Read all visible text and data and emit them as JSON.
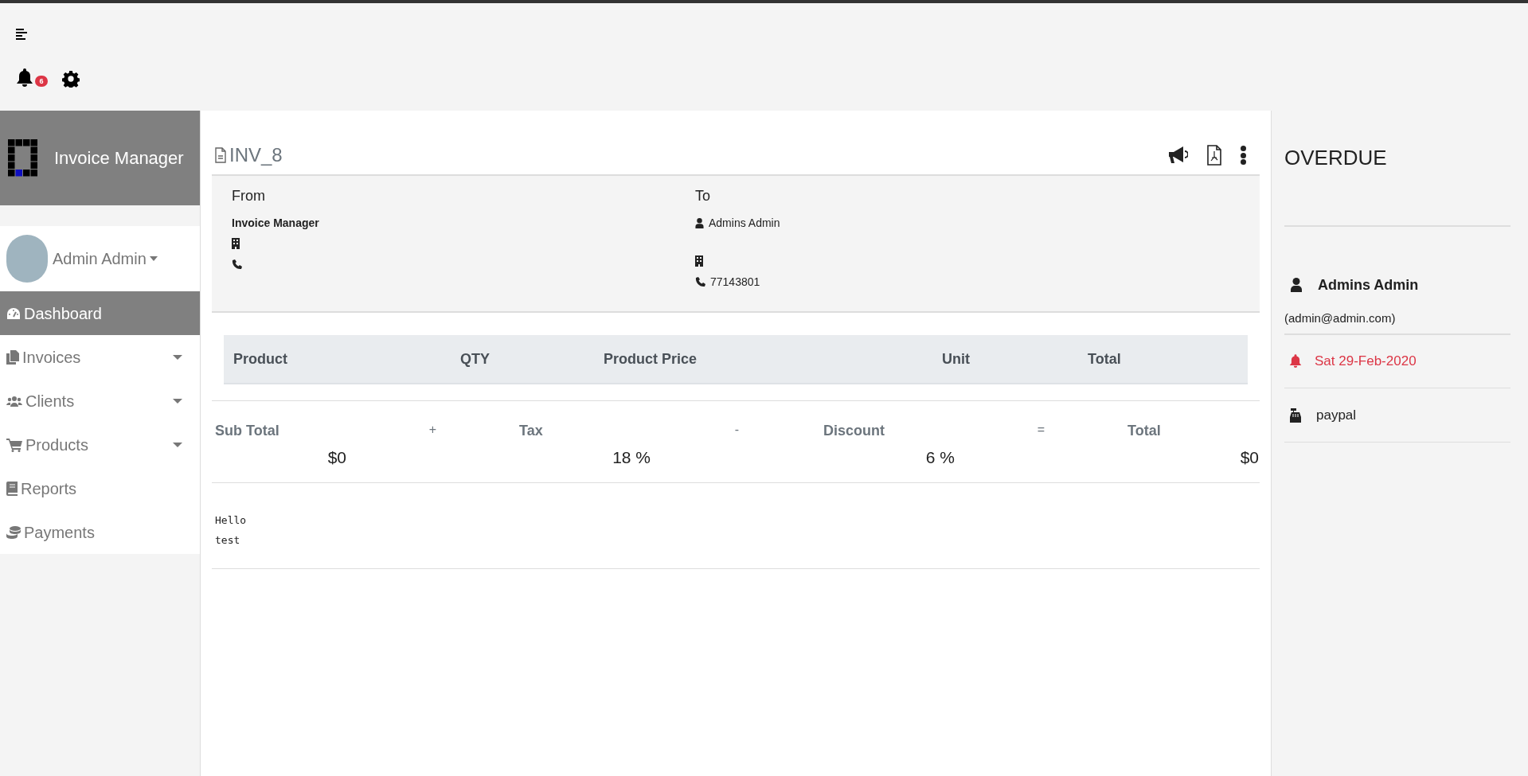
{
  "header": {
    "notification_count": "6"
  },
  "sidebar": {
    "brand": "Invoice Manager",
    "user": "Admin Admin",
    "items": [
      {
        "label": "Dashboard",
        "kind": "link",
        "selected": true
      },
      {
        "label": "Invoices",
        "kind": "dropdown",
        "selected": false
      },
      {
        "label": "Clients",
        "kind": "dropdown",
        "selected": false
      },
      {
        "label": "Products",
        "kind": "dropdown",
        "selected": false
      },
      {
        "label": "Reports",
        "kind": "link",
        "selected": false
      },
      {
        "label": "Payments",
        "kind": "link",
        "selected": false
      }
    ]
  },
  "invoice": {
    "title": "INV_8",
    "from": {
      "heading": "From",
      "name": "Invoice Manager"
    },
    "to": {
      "heading": "To",
      "name": "Admins Admin",
      "phone": "77143801"
    },
    "table": {
      "columns": [
        "Product",
        "QTY",
        "Product Price",
        "Unit",
        "Total"
      ]
    },
    "totals": [
      {
        "label": "Sub Total",
        "value": "$0"
      },
      {
        "label": "Tax",
        "value": "18 %"
      },
      {
        "label": "Discount",
        "value": "6 %"
      },
      {
        "label": "Total",
        "value": "$0"
      }
    ],
    "operators": [
      "+",
      "-",
      "="
    ],
    "notes": [
      "Hello",
      "test"
    ]
  },
  "status_panel": {
    "status": "OVERDUE",
    "client_name": "Admins Admin",
    "client_email": "(admin@admin.com)",
    "due_date": "Sat 29-Feb-2020",
    "payment_method": "paypal"
  }
}
